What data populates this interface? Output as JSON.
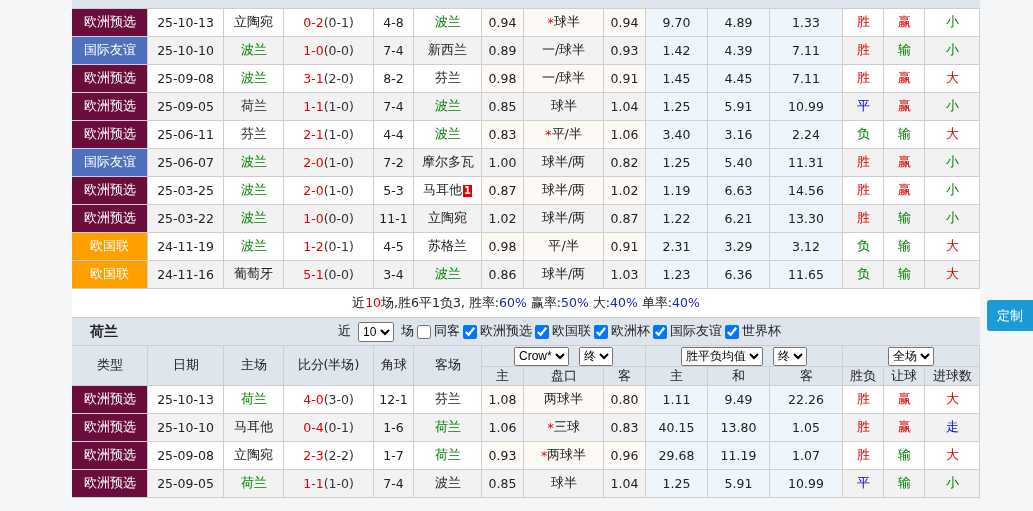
{
  "recent": {
    "rows": [
      {
        "league": {
          "text": "欧洲预选",
          "color": "#6b0d3c"
        },
        "date": "25-10-13",
        "home": {
          "text": "立陶宛",
          "highlighted": false
        },
        "score": "0-2",
        "half": "(0-1)",
        "corners": "4-8",
        "away": {
          "text": "波兰",
          "highlighted": true
        },
        "ah_home": "0.94",
        "handicap": {
          "mark": "*",
          "text": "球半"
        },
        "ah_away": "0.94",
        "eu_home": "9.70",
        "eu_draw": "4.89",
        "eu_away": "1.33",
        "result": {
          "text": "胜",
          "kind": "win"
        },
        "handicap_result": {
          "text": "赢",
          "kind": "win"
        },
        "goals": {
          "text": "小",
          "kind": "under"
        }
      },
      {
        "league": {
          "text": "国际友谊",
          "color": "#4f6fbf"
        },
        "date": "25-10-10",
        "home": {
          "text": "波兰",
          "highlighted": true
        },
        "score": "1-0",
        "half": "(0-0)",
        "corners": "7-4",
        "away": {
          "text": "新西兰",
          "highlighted": false
        },
        "ah_home": "0.89",
        "handicap": {
          "text": "一/球半"
        },
        "ah_away": "0.93",
        "eu_home": "1.42",
        "eu_draw": "4.39",
        "eu_away": "7.11",
        "result": {
          "text": "胜",
          "kind": "win"
        },
        "handicap_result": {
          "text": "输",
          "kind": "loss"
        },
        "goals": {
          "text": "小",
          "kind": "under"
        }
      },
      {
        "league": {
          "text": "欧洲预选",
          "color": "#6b0d3c"
        },
        "date": "25-09-08",
        "home": {
          "text": "波兰",
          "highlighted": true
        },
        "score": "3-1",
        "half": "(2-0)",
        "corners": "8-2",
        "away": {
          "text": "芬兰",
          "highlighted": false
        },
        "ah_home": "0.98",
        "handicap": {
          "text": "一/球半"
        },
        "ah_away": "0.91",
        "eu_home": "1.45",
        "eu_draw": "4.45",
        "eu_away": "7.11",
        "result": {
          "text": "胜",
          "kind": "win"
        },
        "handicap_result": {
          "text": "赢",
          "kind": "win"
        },
        "goals": {
          "text": "大",
          "kind": "over"
        }
      },
      {
        "league": {
          "text": "欧洲预选",
          "color": "#6b0d3c"
        },
        "date": "25-09-05",
        "home": {
          "text": "荷兰",
          "highlighted": false
        },
        "score": "1-1",
        "half": "(1-0)",
        "corners": "7-4",
        "away": {
          "text": "波兰",
          "highlighted": true
        },
        "ah_home": "0.85",
        "handicap": {
          "text": "球半"
        },
        "ah_away": "1.04",
        "eu_home": "1.25",
        "eu_draw": "5.91",
        "eu_away": "10.99",
        "result": {
          "text": "平",
          "kind": "draw"
        },
        "handicap_result": {
          "text": "赢",
          "kind": "win"
        },
        "goals": {
          "text": "小",
          "kind": "under"
        }
      },
      {
        "league": {
          "text": "欧洲预选",
          "color": "#6b0d3c"
        },
        "date": "25-06-11",
        "home": {
          "text": "芬兰",
          "highlighted": false
        },
        "score": "2-1",
        "half": "(1-0)",
        "corners": "4-4",
        "away": {
          "text": "波兰",
          "highlighted": true
        },
        "ah_home": "0.83",
        "handicap": {
          "mark": "*",
          "text": "平/半"
        },
        "ah_away": "1.06",
        "eu_home": "3.40",
        "eu_draw": "3.16",
        "eu_away": "2.24",
        "result": {
          "text": "负",
          "kind": "loss"
        },
        "handicap_result": {
          "text": "输",
          "kind": "loss"
        },
        "goals": {
          "text": "大",
          "kind": "over"
        }
      },
      {
        "league": {
          "text": "国际友谊",
          "color": "#4f6fbf"
        },
        "date": "25-06-07",
        "home": {
          "text": "波兰",
          "highlighted": true
        },
        "score": "2-0",
        "half": "(1-0)",
        "corners": "7-2",
        "away": {
          "text": "摩尔多瓦",
          "highlighted": false
        },
        "ah_home": "1.00",
        "handicap": {
          "text": "球半/两"
        },
        "ah_away": "0.82",
        "eu_home": "1.25",
        "eu_draw": "5.40",
        "eu_away": "11.31",
        "result": {
          "text": "胜",
          "kind": "win"
        },
        "handicap_result": {
          "text": "赢",
          "kind": "win"
        },
        "goals": {
          "text": "小",
          "kind": "under"
        }
      },
      {
        "league": {
          "text": "欧洲预选",
          "color": "#6b0d3c"
        },
        "date": "25-03-25",
        "home": {
          "text": "波兰",
          "highlighted": true
        },
        "score": "2-0",
        "half": "(1-0)",
        "corners": "5-3",
        "away": {
          "text": "马耳他",
          "highlighted": false,
          "red_cards": "1"
        },
        "ah_home": "0.87",
        "handicap": {
          "text": "球半/两"
        },
        "ah_away": "1.02",
        "eu_home": "1.19",
        "eu_draw": "6.63",
        "eu_away": "14.56",
        "result": {
          "text": "胜",
          "kind": "win"
        },
        "handicap_result": {
          "text": "赢",
          "kind": "win"
        },
        "goals": {
          "text": "小",
          "kind": "under"
        }
      },
      {
        "league": {
          "text": "欧洲预选",
          "color": "#6b0d3c"
        },
        "date": "25-03-22",
        "home": {
          "text": "波兰",
          "highlighted": true
        },
        "score": "1-0",
        "half": "(0-0)",
        "corners": "11-1",
        "away": {
          "text": "立陶宛",
          "highlighted": false
        },
        "ah_home": "1.02",
        "handicap": {
          "text": "球半/两"
        },
        "ah_away": "0.87",
        "eu_home": "1.22",
        "eu_draw": "6.21",
        "eu_away": "13.30",
        "result": {
          "text": "胜",
          "kind": "win"
        },
        "handicap_result": {
          "text": "输",
          "kind": "loss"
        },
        "goals": {
          "text": "小",
          "kind": "under"
        }
      },
      {
        "league": {
          "text": "欧国联",
          "color": "#ff9f00"
        },
        "date": "24-11-19",
        "home": {
          "text": "波兰",
          "highlighted": true
        },
        "score": "1-2",
        "half": "(0-1)",
        "corners": "4-5",
        "away": {
          "text": "苏格兰",
          "highlighted": false
        },
        "ah_home": "0.98",
        "handicap": {
          "text": "平/半"
        },
        "ah_away": "0.91",
        "eu_home": "2.31",
        "eu_draw": "3.29",
        "eu_away": "3.12",
        "result": {
          "text": "负",
          "kind": "loss"
        },
        "handicap_result": {
          "text": "输",
          "kind": "loss"
        },
        "goals": {
          "text": "大",
          "kind": "over"
        }
      },
      {
        "league": {
          "text": "欧国联",
          "color": "#ff9f00"
        },
        "date": "24-11-16",
        "home": {
          "text": "葡萄牙",
          "highlighted": false
        },
        "score": "5-1",
        "half": "(0-0)",
        "corners": "3-4",
        "away": {
          "text": "波兰",
          "highlighted": true
        },
        "ah_home": "0.86",
        "handicap": {
          "text": "球半/两"
        },
        "ah_away": "1.03",
        "eu_home": "1.23",
        "eu_draw": "6.36",
        "eu_away": "11.65",
        "result": {
          "text": "负",
          "kind": "loss"
        },
        "handicap_result": {
          "text": "输",
          "kind": "loss"
        },
        "goals": {
          "text": "大",
          "kind": "over"
        }
      }
    ],
    "summary": [
      {
        "kind": "plain",
        "text": "近"
      },
      {
        "kind": "count",
        "text": "10"
      },
      {
        "kind": "plain",
        "text": "场,胜6平1负3, 胜率:"
      },
      {
        "kind": "rate",
        "text": "60%"
      },
      {
        "kind": "plain",
        "text": " 赢率:"
      },
      {
        "kind": "rate",
        "text": "50%"
      },
      {
        "kind": "plain",
        "text": " 大:"
      },
      {
        "kind": "rate",
        "text": "40%"
      },
      {
        "kind": "plain",
        "text": " 单率:"
      },
      {
        "kind": "rate",
        "text": "40%"
      }
    ]
  },
  "second": {
    "title": "荷兰",
    "filter": {
      "prefix": "近",
      "count": "10",
      "suffix": "场",
      "same_venue": {
        "label": "同客",
        "checked": false
      },
      "competitions": [
        {
          "label": "欧洲预选",
          "checked": true
        },
        {
          "label": "欧国联",
          "checked": true
        },
        {
          "label": "欧洲杯",
          "checked": true
        },
        {
          "label": "国际友谊",
          "checked": true
        },
        {
          "label": "世界杯",
          "checked": true
        }
      ]
    },
    "columns": [
      "类型",
      "日期",
      "主场",
      "比分(半场)",
      "角球",
      "客场"
    ],
    "selects": {
      "company": "Crow*",
      "handicap_stage": "终",
      "odds_type": "胜平负均值",
      "odds_stage": "终",
      "period": "全场"
    },
    "sub_columns": [
      "主",
      "盘口",
      "客",
      "主",
      "和",
      "客",
      "胜负",
      "让球",
      "进球数"
    ],
    "rows": [
      {
        "league": {
          "text": "欧洲预选",
          "color": "#6b0d3c"
        },
        "date": "25-10-13",
        "home": {
          "text": "荷兰",
          "highlighted": true
        },
        "score": "4-0",
        "half": "(3-0)",
        "corners": "12-1",
        "away": {
          "text": "芬兰",
          "highlighted": false
        },
        "ah_home": "1.08",
        "handicap": {
          "text": "两球半"
        },
        "ah_away": "0.80",
        "eu_home": "1.11",
        "eu_draw": "9.49",
        "eu_away": "22.26",
        "result": {
          "text": "胜",
          "kind": "win"
        },
        "handicap_result": {
          "text": "赢",
          "kind": "win"
        },
        "goals": {
          "text": "大",
          "kind": "over"
        }
      },
      {
        "league": {
          "text": "欧洲预选",
          "color": "#6b0d3c"
        },
        "date": "25-10-10",
        "home": {
          "text": "马耳他",
          "highlighted": false
        },
        "score": "0-4",
        "half": "(0-1)",
        "corners": "1-6",
        "away": {
          "text": "荷兰",
          "highlighted": true
        },
        "ah_home": "1.06",
        "handicap": {
          "mark": "*",
          "text": "三球"
        },
        "ah_away": "0.83",
        "eu_home": "40.15",
        "eu_draw": "13.80",
        "eu_away": "1.05",
        "result": {
          "text": "胜",
          "kind": "win"
        },
        "handicap_result": {
          "text": "赢",
          "kind": "win"
        },
        "goals": {
          "text": "走",
          "kind": "push"
        }
      },
      {
        "league": {
          "text": "欧洲预选",
          "color": "#6b0d3c"
        },
        "date": "25-09-08",
        "home": {
          "text": "立陶宛",
          "highlighted": false
        },
        "score": "2-3",
        "half": "(2-2)",
        "corners": "1-7",
        "away": {
          "text": "荷兰",
          "highlighted": true
        },
        "ah_home": "0.93",
        "handicap": {
          "mark": "*",
          "text": "两球半"
        },
        "ah_away": "0.96",
        "eu_home": "29.68",
        "eu_draw": "11.19",
        "eu_away": "1.07",
        "result": {
          "text": "胜",
          "kind": "win"
        },
        "handicap_result": {
          "text": "输",
          "kind": "loss"
        },
        "goals": {
          "text": "大",
          "kind": "over"
        }
      },
      {
        "league": {
          "text": "欧洲预选",
          "color": "#6b0d3c"
        },
        "date": "25-09-05",
        "home": {
          "text": "荷兰",
          "highlighted": true
        },
        "score": "1-1",
        "half": "(1-0)",
        "corners": "7-4",
        "away": {
          "text": "波兰",
          "highlighted": false
        },
        "ah_home": "0.85",
        "handicap": {
          "text": "球半"
        },
        "ah_away": "1.04",
        "eu_home": "1.25",
        "eu_draw": "5.91",
        "eu_away": "10.99",
        "result": {
          "text": "平",
          "kind": "draw"
        },
        "handicap_result": {
          "text": "输",
          "kind": "loss"
        },
        "goals": {
          "text": "小",
          "kind": "under"
        }
      }
    ]
  },
  "side_button": "定制"
}
